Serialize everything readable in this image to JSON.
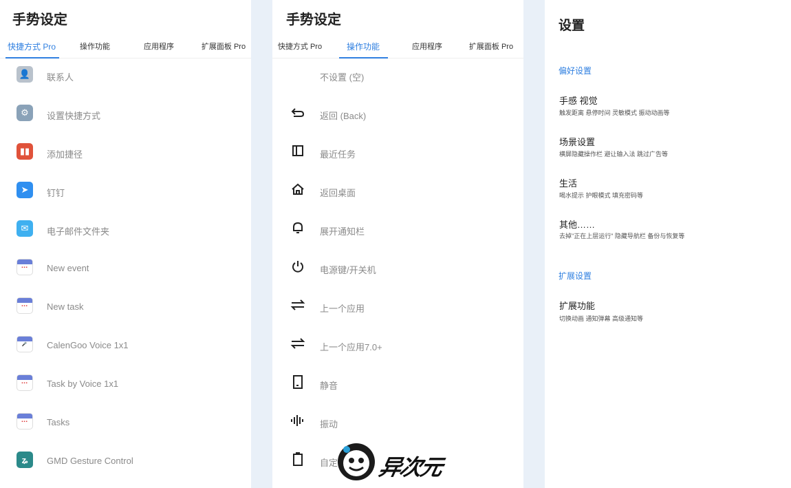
{
  "left": {
    "title": "手势设定",
    "tabs": [
      "快捷方式 Pro",
      "操作功能",
      "应用程序",
      "扩展面板 Pro"
    ],
    "active_tab": 0,
    "items": [
      {
        "label": "联系人",
        "icon": "contact-icon",
        "color": "#b9c2cc"
      },
      {
        "label": "设置快捷方式",
        "icon": "settings-gear-icon",
        "color": "#8aa2b8"
      },
      {
        "label": "添加捷径",
        "icon": "shortcut-icon",
        "color": "#e0523a"
      },
      {
        "label": "钉钉",
        "icon": "dingtalk-icon",
        "color": "#2f8ff0"
      },
      {
        "label": "电子邮件文件夹",
        "icon": "mail-icon",
        "color": "#3fb0f0"
      },
      {
        "label": "New event",
        "icon": "calendar-icon",
        "color": "#6a7fd8"
      },
      {
        "label": "New task",
        "icon": "calendar-icon",
        "color": "#6a7fd8"
      },
      {
        "label": "CalenGoo Voice 1x1",
        "icon": "calendar-mic-icon",
        "color": "#6a7fd8"
      },
      {
        "label": "Task by Voice 1x1",
        "icon": "calendar-icon",
        "color": "#6a7fd8"
      },
      {
        "label": "Tasks",
        "icon": "calendar-icon",
        "color": "#6a7fd8"
      },
      {
        "label": "GMD Gesture Control",
        "icon": "gesture-icon",
        "color": "#2b8a8a"
      }
    ]
  },
  "middle": {
    "title": "手势设定",
    "tabs": [
      "快捷方式 Pro",
      "操作功能",
      "应用程序",
      "扩展面板 Pro"
    ],
    "active_tab": 1,
    "items": [
      {
        "label": "不设置 (空)",
        "icon": "none",
        "glyph": ""
      },
      {
        "label": "返回 (Back)",
        "icon": "back-icon",
        "glyph": "⮌"
      },
      {
        "label": "最近任务",
        "icon": "recent-tasks-icon",
        "glyph": "◫"
      },
      {
        "label": "返回桌面",
        "icon": "home-icon",
        "glyph": "⌂"
      },
      {
        "label": "展开通知栏",
        "icon": "bell-icon",
        "glyph": "🔔"
      },
      {
        "label": "电源键/开关机",
        "icon": "power-icon",
        "glyph": "⏻"
      },
      {
        "label": "上一个应用",
        "icon": "switch-app-icon",
        "glyph": "⇆"
      },
      {
        "label": "上一个应用7.0+",
        "icon": "switch-app-icon",
        "glyph": "⇆"
      },
      {
        "label": "静音",
        "icon": "phone-silent-icon",
        "glyph": "▯"
      },
      {
        "label": "振动",
        "icon": "vibrate-icon",
        "glyph": "ılıl"
      },
      {
        "label": "自定",
        "icon": "battery-icon",
        "glyph": "▯"
      }
    ]
  },
  "right": {
    "title": "设置",
    "sections": [
      {
        "header": "偏好设置",
        "items": [
          {
            "title": "手感 视觉",
            "subtitle": "触发距离 悬停时间 灵敏模式 振动动画等"
          },
          {
            "title": "场景设置",
            "subtitle": "横屏隐藏操作栏 避让输入法 跳过广告等"
          },
          {
            "title": "生活",
            "subtitle": "喝水提示  护眼模式  填充密码等"
          },
          {
            "title": "其他……",
            "subtitle": "去掉\"正在上层运行\" 隐藏导航栏  备份与恢复等"
          }
        ]
      },
      {
        "header": "扩展设置",
        "items": [
          {
            "title": "扩展功能",
            "subtitle": "切换动画 通知弹幕 高级通知等"
          }
        ]
      }
    ]
  },
  "watermark": {
    "text": "异次元"
  },
  "accent_color": "#2f7fe0"
}
